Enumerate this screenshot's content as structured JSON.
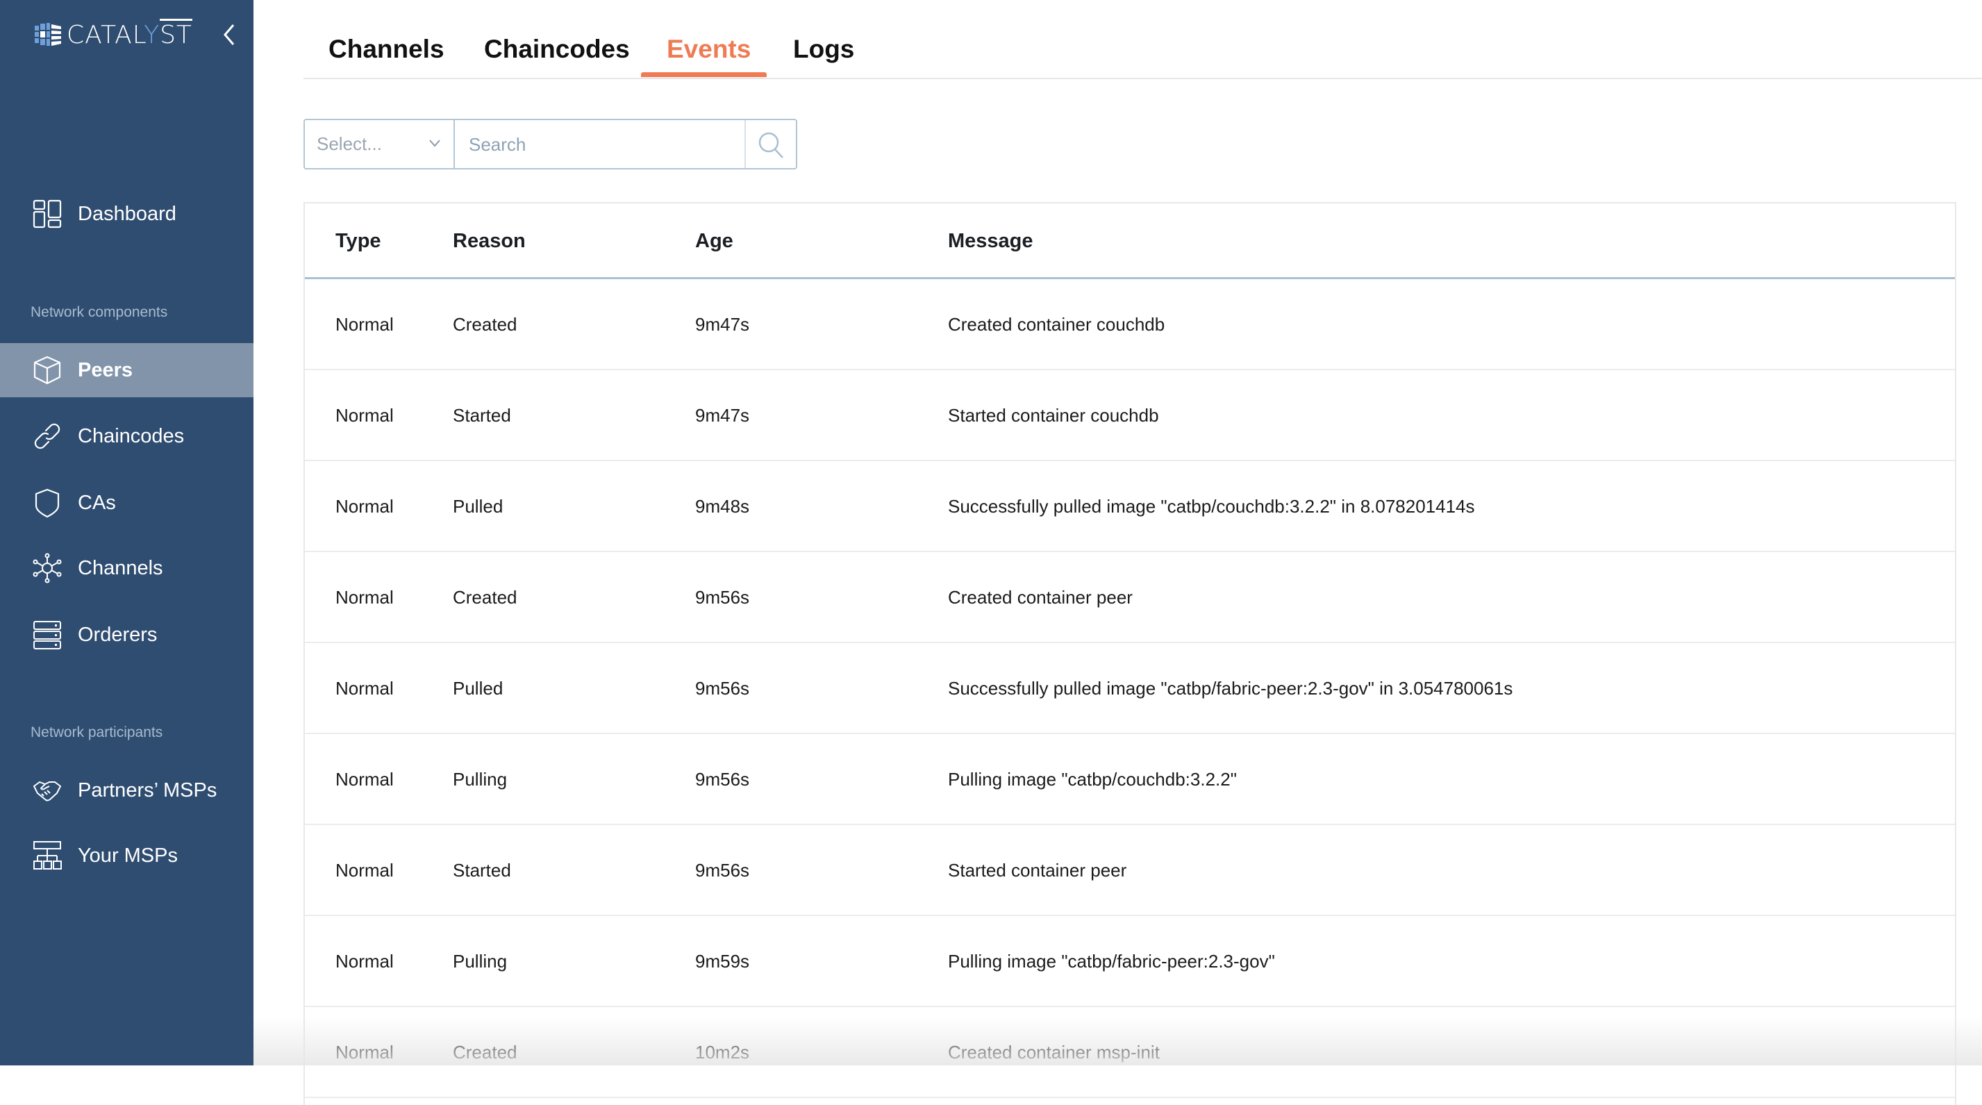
{
  "app": {
    "brand": "CATALYST",
    "brand_parts": {
      "before": "CATAL",
      "accent": "Y",
      "after": "ST"
    },
    "colors": {
      "sidebar": "#2f4d70",
      "active_item": "#8294aa",
      "accent": "#ef7b55",
      "logo_accent": "#6ea0dc"
    }
  },
  "sidebar": {
    "dashboard": {
      "label": "Dashboard",
      "icon": "dashboard-icon"
    },
    "sections": [
      {
        "label": "Network components",
        "items": [
          {
            "label": "Peers",
            "icon": "cube-icon",
            "active": true
          },
          {
            "label": "Chaincodes",
            "icon": "link-icon",
            "active": false
          },
          {
            "label": "CAs",
            "icon": "shield-icon",
            "active": false
          },
          {
            "label": "Channels",
            "icon": "network-hub-icon",
            "active": false
          },
          {
            "label": "Orderers",
            "icon": "server-stack-icon",
            "active": false
          }
        ]
      },
      {
        "label": "Network participants",
        "items": [
          {
            "label": "Partners’ MSPs",
            "icon": "handshake-icon",
            "active": false
          },
          {
            "label": "Your MSPs",
            "icon": "org-chart-icon",
            "active": false
          }
        ]
      }
    ]
  },
  "tabs": [
    {
      "label": "Channels",
      "active": false
    },
    {
      "label": "Chaincodes",
      "active": false
    },
    {
      "label": "Events",
      "active": true
    },
    {
      "label": "Logs",
      "active": false
    }
  ],
  "filter": {
    "select_placeholder": "Select...",
    "search_placeholder": "Search",
    "search_value": ""
  },
  "table": {
    "columns": [
      "Type",
      "Reason",
      "Age",
      "Message"
    ],
    "rows": [
      {
        "type": "Normal",
        "reason": "Created",
        "age": "9m47s",
        "message": "Created container couchdb"
      },
      {
        "type": "Normal",
        "reason": "Started",
        "age": "9m47s",
        "message": "Started container couchdb"
      },
      {
        "type": "Normal",
        "reason": "Pulled",
        "age": "9m48s",
        "message": "Successfully pulled image \"catbp/couchdb:3.2.2\" in 8.078201414s"
      },
      {
        "type": "Normal",
        "reason": "Created",
        "age": "9m56s",
        "message": "Created container peer"
      },
      {
        "type": "Normal",
        "reason": "Pulled",
        "age": "9m56s",
        "message": "Successfully pulled image \"catbp/fabric-peer:2.3-gov\" in 3.054780061s"
      },
      {
        "type": "Normal",
        "reason": "Pulling",
        "age": "9m56s",
        "message": "Pulling image \"catbp/couchdb:3.2.2\""
      },
      {
        "type": "Normal",
        "reason": "Started",
        "age": "9m56s",
        "message": "Started container peer"
      },
      {
        "type": "Normal",
        "reason": "Pulling",
        "age": "9m59s",
        "message": "Pulling image \"catbp/fabric-peer:2.3-gov\""
      },
      {
        "type": "Normal",
        "reason": "Created",
        "age": "10m2s",
        "message": "Created container msp-init"
      }
    ]
  }
}
